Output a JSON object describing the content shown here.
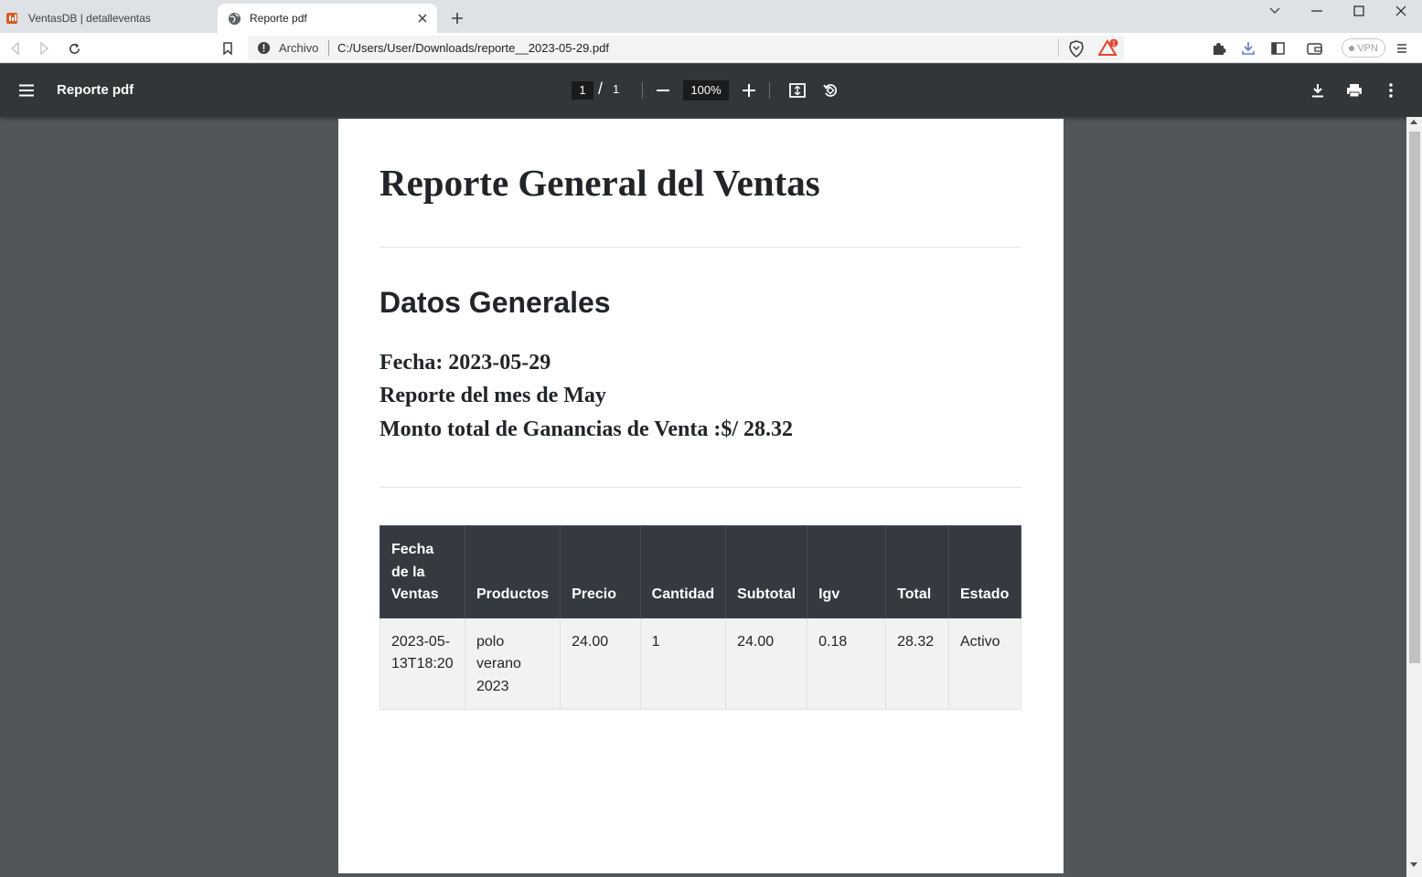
{
  "browser": {
    "tabs": [
      {
        "title": "VentasDB | detalleventas",
        "active": false
      },
      {
        "title": "Reporte pdf",
        "active": true
      }
    ],
    "omnibox": {
      "security_label": "Archivo",
      "url": "C:/Users/User/Downloads/reporte__2023-05-29.pdf"
    },
    "alerts_badge": "1",
    "vpn_label": "VPN"
  },
  "viewer": {
    "title": "Reporte pdf",
    "page_current": "1",
    "page_separator": "/",
    "page_total": "1",
    "zoom": "100%"
  },
  "document": {
    "title": "Reporte General del Ventas",
    "section_title": "Datos Generales",
    "fecha_line": "Fecha: 2023-05-29",
    "mes_line": "Reporte del mes de May",
    "monto_line": "Monto total de Ganancias de Venta :$/ 28.32",
    "table": {
      "headers": [
        "Fecha de la Ventas",
        "Productos",
        "Precio",
        "Cantidad",
        "Subtotal",
        "Igv",
        "Total",
        "Estado"
      ],
      "rows": [
        [
          "2023-05-13T18:20",
          "polo verano 2023",
          "24.00",
          "1",
          "24.00",
          "0.18",
          "28.32",
          "Activo"
        ]
      ]
    }
  },
  "colors": {
    "viewer_bg": "#525659",
    "viewer_toolbar": "#323639",
    "table_header_bg": "#343a40",
    "table_row_bg": "#f2f2f2"
  }
}
